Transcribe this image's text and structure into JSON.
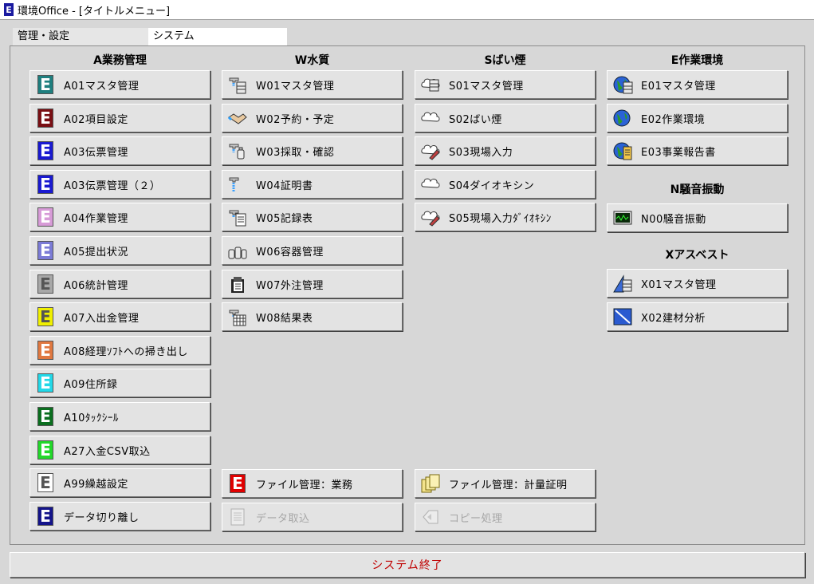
{
  "window": {
    "title": "環境Office - [タイトルメニュー]"
  },
  "tabs": [
    {
      "label": "管理・設定"
    },
    {
      "label": "システム"
    }
  ],
  "columns": {
    "a": {
      "title": "A業務管理"
    },
    "w": {
      "title": "W水質"
    },
    "s": {
      "title": "Sばい煙"
    },
    "e": {
      "title": "E作業環境"
    },
    "n": {
      "title": "N騒音振動"
    },
    "x": {
      "title": "Xアスベスト"
    }
  },
  "a_buttons": [
    {
      "label": "A01マスタ管理",
      "color": "#1f7f7f"
    },
    {
      "label": "A02項目設定",
      "color": "#7a0f14"
    },
    {
      "label": "A03伝票管理",
      "color": "#1a1ad0"
    },
    {
      "label": "A03伝票管理（２）",
      "color": "#1a1ad0"
    },
    {
      "label": "A04作業管理",
      "color": "#d79bd7"
    },
    {
      "label": "A05提出状況",
      "color": "#7b7bd6"
    },
    {
      "label": "A06統計管理",
      "color": "#a8a8a8"
    },
    {
      "label": "A07入出金管理",
      "color": "#f0f000"
    },
    {
      "label": "A08経理ｿﾌﾄへの掃き出し",
      "color": "#e07840"
    },
    {
      "label": "A09住所録",
      "color": "#22d8e8"
    },
    {
      "label": "A10ﾀｯｸｼｰﾙ",
      "color": "#0a6e1e"
    },
    {
      "label": "A27入金CSV取込",
      "color": "#22d82a"
    },
    {
      "label": "A99繰越設定",
      "color": "#ffffff"
    },
    {
      "label": "データ切り離し",
      "color": "#14148a"
    }
  ],
  "w_buttons": [
    {
      "label": "W01マスタ管理",
      "icon": "faucet-cabinet-icon"
    },
    {
      "label": "W02予約・予定",
      "icon": "handshake-icon"
    },
    {
      "label": "W03採取・確認",
      "icon": "faucet-bottle-icon"
    },
    {
      "label": "W04証明書",
      "icon": "faucet-document-icon"
    },
    {
      "label": "W05記録表",
      "icon": "faucet-record-icon"
    },
    {
      "label": "W06容器管理",
      "icon": "bottles-icon"
    },
    {
      "label": "W07外注管理",
      "icon": "clipboard-icon"
    },
    {
      "label": "W08結果表",
      "icon": "faucet-grid-icon"
    }
  ],
  "s_buttons": [
    {
      "label": "S01マスタ管理",
      "icon": "smoke-cabinet-icon"
    },
    {
      "label": "S02ばい煙",
      "icon": "smoke-cloud-icon"
    },
    {
      "label": "S03現場入力",
      "icon": "smoke-pencil-icon"
    },
    {
      "label": "S04ダイオキシン",
      "icon": "smoke-cloud-icon"
    },
    {
      "label": "S05現場入力ﾀﾞｲｵｷｼﾝ",
      "icon": "smoke-pencil-icon"
    }
  ],
  "e_buttons": [
    {
      "label": "E01マスタ管理",
      "icon": "globe-cabinet-icon"
    },
    {
      "label": "E02作業環境",
      "icon": "globe-icon"
    },
    {
      "label": "E03事業報告書",
      "icon": "globe-report-icon"
    }
  ],
  "n_buttons": [
    {
      "label": "N00騒音振動",
      "icon": "oscilloscope-icon"
    }
  ],
  "x_buttons": [
    {
      "label": "X01マスタ管理",
      "icon": "asbestos-cabinet-icon"
    },
    {
      "label": "X02建材分析",
      "icon": "asbestos-analysis-icon"
    }
  ],
  "bottom_buttons": {
    "file_business": {
      "label": "ファイル管理：業務",
      "color": "#e00000"
    },
    "file_cert": {
      "label": "ファイル管理：計量証明"
    },
    "data_import": {
      "label": "データ取込",
      "enabled": false
    },
    "copy_process": {
      "label": "コピー処理",
      "enabled": false
    }
  },
  "exit": {
    "label": "システム終了",
    "color": "#c00000"
  }
}
